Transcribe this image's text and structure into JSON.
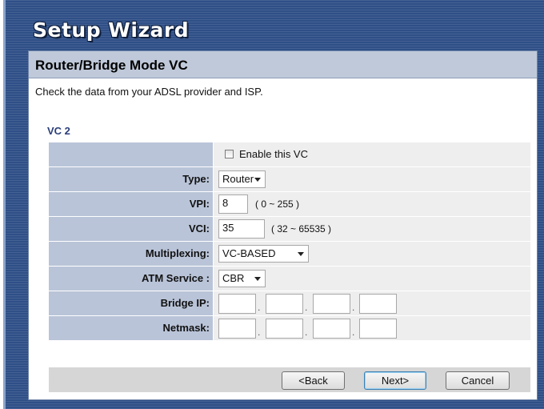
{
  "wizard": {
    "title": "Setup Wizard"
  },
  "panel": {
    "title": "Router/Bridge Mode VC",
    "instruction": "Check the data from your ADSL provider and ISP.",
    "vc_label": "VC 2"
  },
  "form": {
    "enable": {
      "label": "Enable this VC",
      "checked": false
    },
    "type": {
      "label": "Type:",
      "value": "Router"
    },
    "vpi": {
      "label": "VPI:",
      "value": "8",
      "hint": "( 0 ~ 255 )"
    },
    "vci": {
      "label": "VCI:",
      "value": "35",
      "hint": "( 32 ~ 65535 )"
    },
    "multiplexing": {
      "label": "Multiplexing:",
      "value": "VC-BASED"
    },
    "atm_service": {
      "label": "ATM Service :",
      "value": "CBR"
    },
    "bridge_ip": {
      "label": "Bridge IP:",
      "octets": [
        "",
        "",
        "",
        ""
      ]
    },
    "netmask": {
      "label": "Netmask:",
      "octets": [
        "",
        "",
        "",
        ""
      ]
    },
    "ip_separator": "."
  },
  "buttons": {
    "back": "<Back",
    "next": "Next>",
    "cancel": "Cancel"
  },
  "colors": {
    "frame": "#2f4f87",
    "label_cell": "#b9c4d8",
    "value_cell": "#eeeeee",
    "header": "#bfc9d9"
  }
}
